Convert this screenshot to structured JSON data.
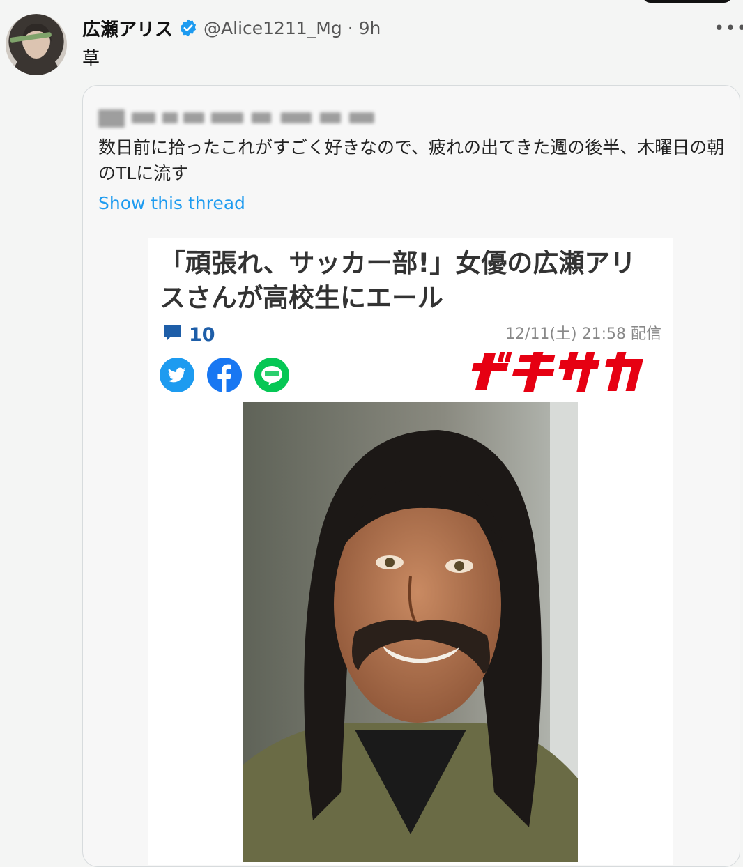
{
  "tweet": {
    "display_name": "広瀬アリス",
    "handle": "@Alice1211_Mg",
    "separator": "·",
    "time": "9h",
    "more_label": "•••",
    "text": "草"
  },
  "quoted_tweet": {
    "text": "数日前に拾ったこれがすごく好きなので、疲れの出てきた週の後半、木曜日の朝のTLに流す",
    "show_thread_label": "Show this thread"
  },
  "article": {
    "headline": "「頑張れ、サッカー部!」女優の広瀬アリスさんが高校生にエール",
    "comment_count": "10",
    "date": "12/11(土) 21:58 配信",
    "share_icons": [
      "twitter-icon",
      "facebook-icon",
      "line-icon"
    ],
    "publisher_logo": "ゲキサカ"
  },
  "colors": {
    "link_blue": "#1d9bf0",
    "logo_red": "#e60012",
    "twitter_blue": "#1d9bf0",
    "facebook_blue": "#1877f2",
    "line_green": "#06c755",
    "comment_blue": "#1e5ea8"
  }
}
